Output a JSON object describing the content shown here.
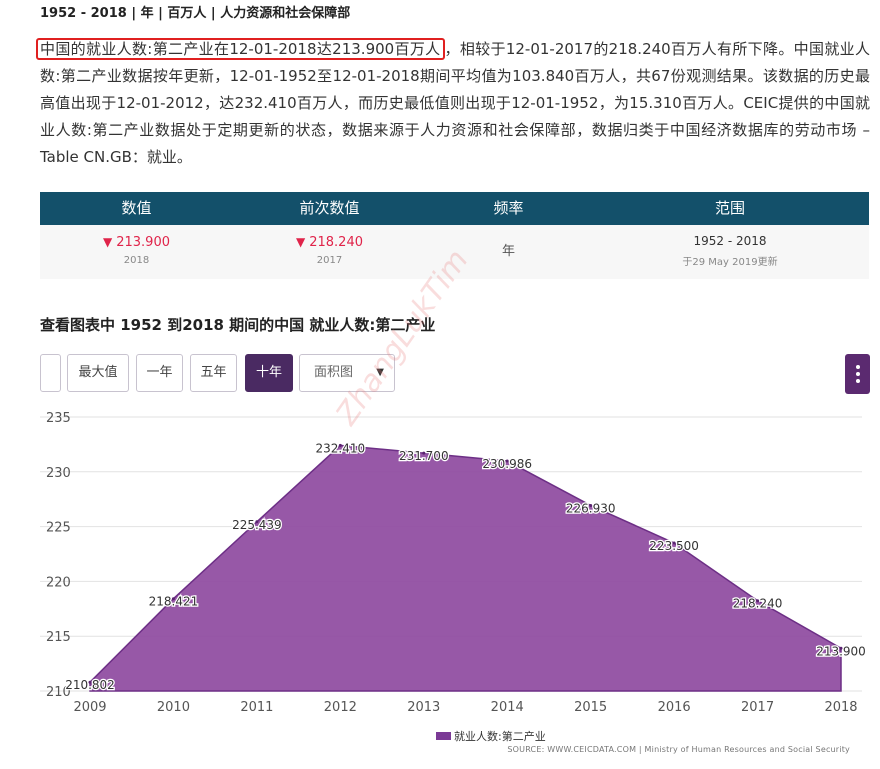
{
  "header": {
    "meta": "1952 - 2018 | 年 | 百万人 | 人力资源和社会保障部"
  },
  "description": {
    "highlight": "中国的就业人数:第二产业在12-01-2018达213.900百万人",
    "rest": "，相较于12-01-2017的218.240百万人有所下降。中国就业人数:第二产业数据按年更新，12-01-1952至12-01-2018期间平均值为103.840百万人，共67份观测结果。该数据的历史最高值出现于12-01-2012，达232.410百万人，而历史最低值则出现于12-01-1952，为15.310百万人。CEIC提供的中国就业人数:第二产业数据处于定期更新的状态，数据来源于人力资源和社会保障部，数据归类于中国经济数据库的劳动市场 – Table CN.GB：就业。"
  },
  "stats": {
    "headers": [
      "数值",
      "前次数值",
      "频率",
      "范围"
    ],
    "value": "213.900",
    "value_year": "2018",
    "prev_value": "218.240",
    "prev_year": "2017",
    "frequency": "年",
    "range": "1952 - 2018",
    "updated": "于29 May 2019更新",
    "down_color": "#e0244a"
  },
  "chart_section": {
    "title": "查看图表中 1952 到2018 期间的中国 就业人数:第二产业",
    "buttons": [
      "最大值",
      "一年",
      "五年",
      "十年"
    ],
    "active_button": "十年",
    "chart_type_select": "面积图",
    "caret": "▼"
  },
  "watermark": "ZhangLukTim",
  "chart_data": {
    "type": "area",
    "x": [
      2009,
      2010,
      2011,
      2012,
      2013,
      2014,
      2015,
      2016,
      2017,
      2018
    ],
    "series": [
      {
        "name": "就业人数:第二产业",
        "values": [
          210.802,
          218.421,
          225.439,
          232.41,
          231.7,
          230.986,
          226.93,
          223.5,
          218.24,
          213.9
        ],
        "color": "#8e4a9f"
      }
    ],
    "value_labels": [
      "210.802",
      "218.421",
      "225.439",
      "232.410",
      "231.700",
      "230.986",
      "226.930",
      "223.500",
      "218.240",
      "213.900"
    ],
    "ylim": [
      210,
      235
    ],
    "yticks": [
      210,
      215,
      220,
      225,
      230,
      235
    ],
    "grid": true,
    "legend": "bottom"
  },
  "source": "SOURCE: WWW.CEICDATA.COM | Ministry of Human Resources and Social Security"
}
